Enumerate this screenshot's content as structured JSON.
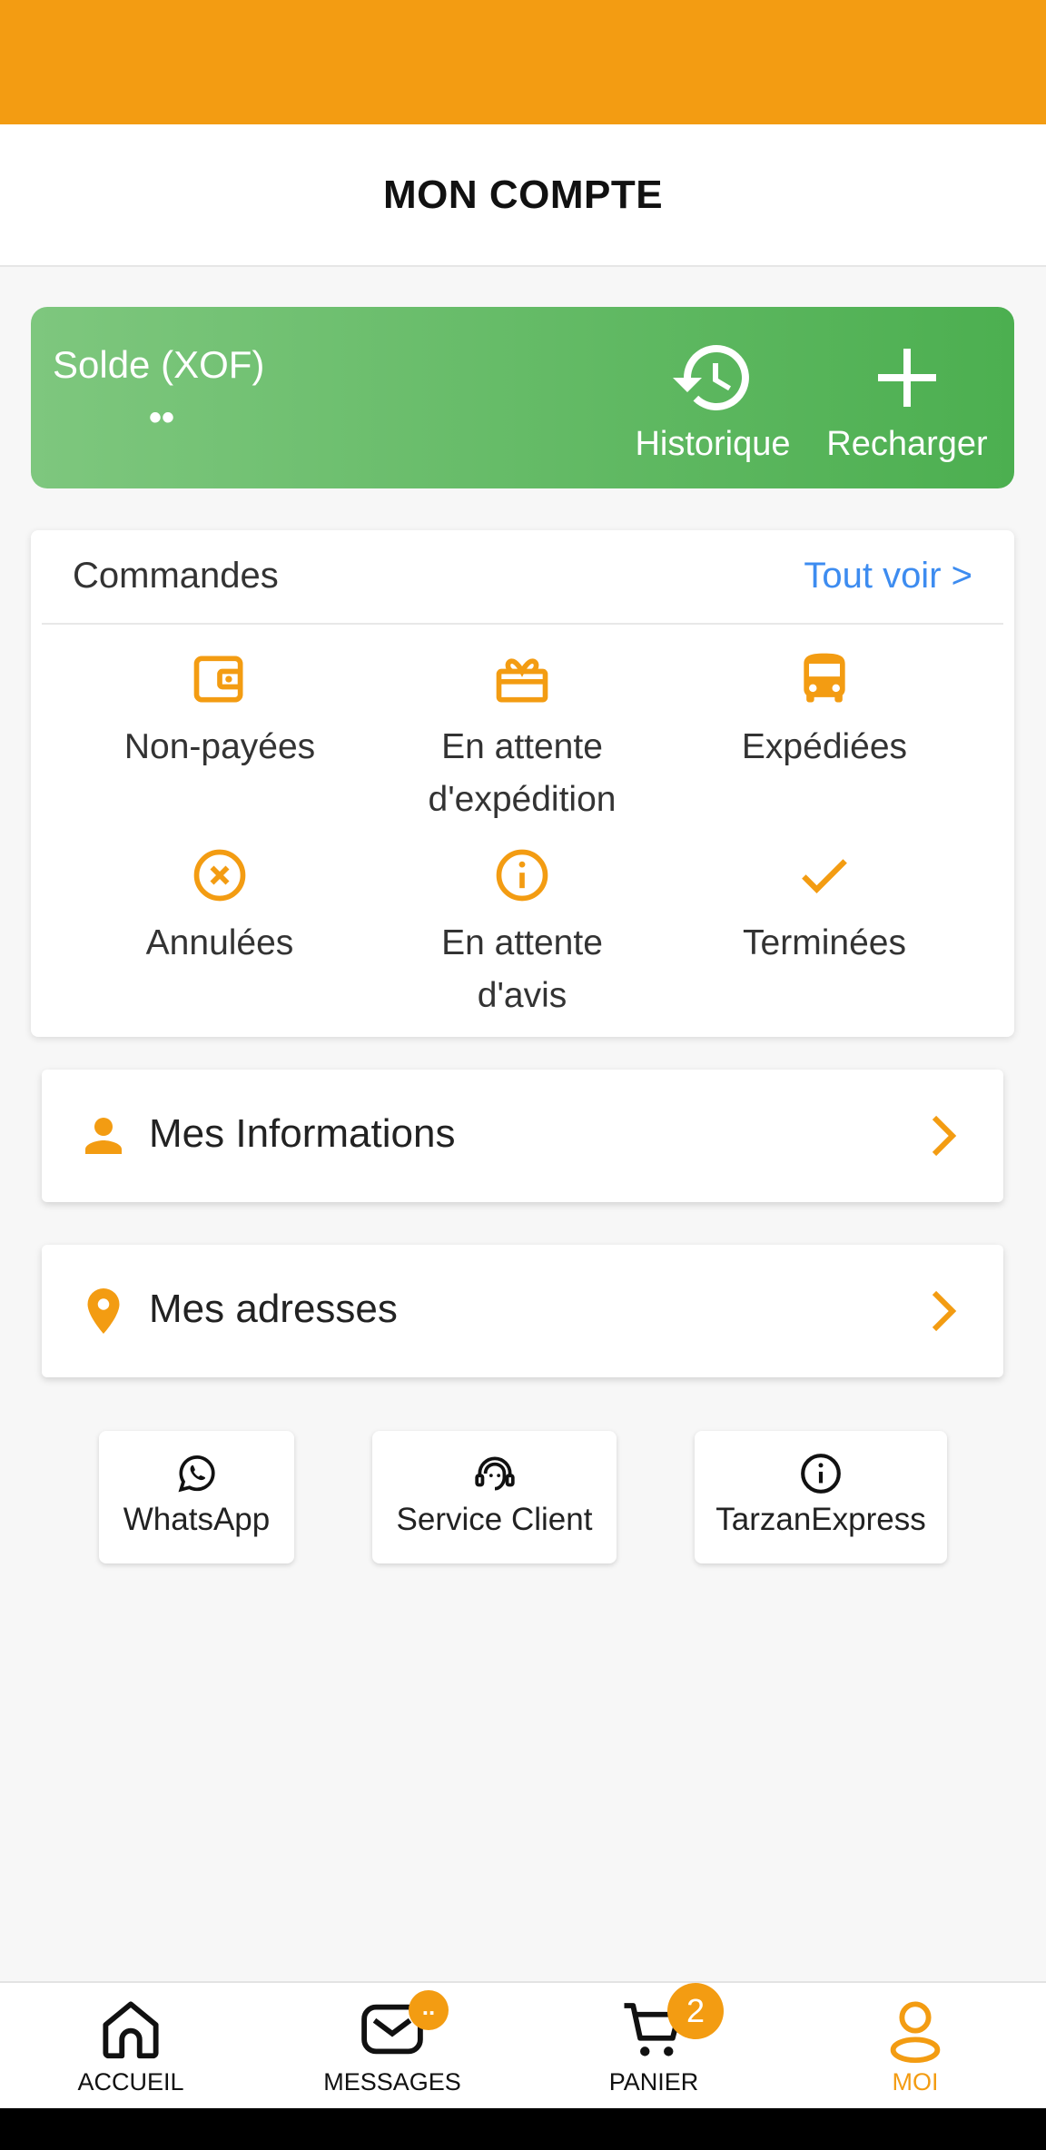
{
  "header": {
    "title": "MON COMPTE"
  },
  "balance": {
    "label": "Solde (XOF)",
    "value": "••",
    "history_label": "Historique",
    "recharge_label": "Recharger"
  },
  "orders": {
    "title": "Commandes",
    "see_all": "Tout voir >",
    "items": [
      {
        "label_1": "Non-payées",
        "label_2": "",
        "icon": "wallet-icon"
      },
      {
        "label_1": "En attente",
        "label_2": "d'expédition",
        "icon": "gift-box-icon"
      },
      {
        "label_1": "Expédiées",
        "label_2": "",
        "icon": "bus-icon"
      },
      {
        "label_1": "Annulées",
        "label_2": "",
        "icon": "cancel-circle-icon"
      },
      {
        "label_1": "En attente",
        "label_2": "d'avis",
        "icon": "info-circle-icon"
      },
      {
        "label_1": "Terminées",
        "label_2": "",
        "icon": "check-icon"
      }
    ]
  },
  "menu": {
    "info_label": "Mes Informations",
    "address_label": "Mes adresses"
  },
  "contacts": [
    {
      "label": "WhatsApp",
      "icon": "whatsapp-icon"
    },
    {
      "label": "Service Client",
      "icon": "headset-icon"
    },
    {
      "label": "TarzanExpress",
      "icon": "info-icon"
    }
  ],
  "nav": {
    "home": "ACCUEIL",
    "messages": "MESSAGES",
    "messages_badge": "..",
    "cart": "PANIER",
    "cart_badge": "2",
    "me": "MOI"
  },
  "colors": {
    "accent": "#f39c12",
    "balance_start": "#7ec77e",
    "balance_end": "#4caf50",
    "link": "#3d8cf0"
  }
}
